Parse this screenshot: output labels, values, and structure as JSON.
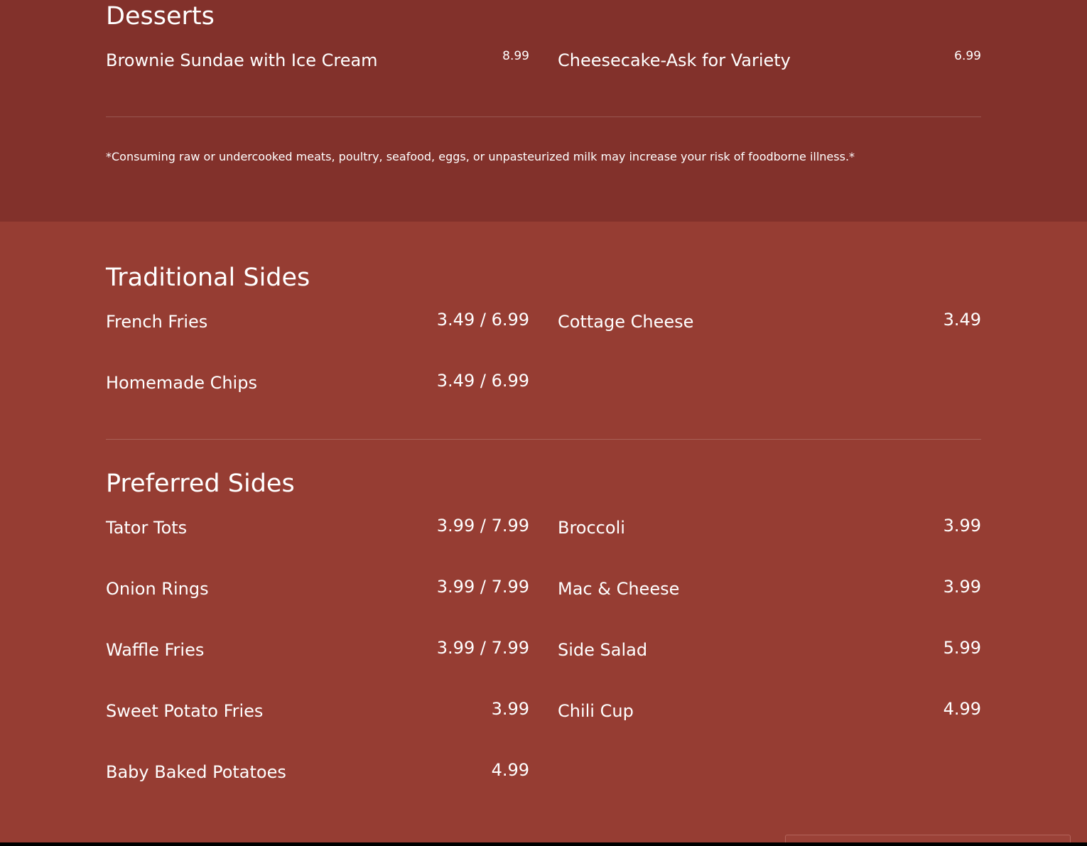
{
  "desserts": {
    "title": "Desserts",
    "items": [
      {
        "name": "Brownie Sundae with Ice Cream",
        "price": "8.99"
      },
      {
        "name": "Cheesecake-Ask for Variety",
        "price": "6.99"
      }
    ]
  },
  "notice": "*Consuming raw or undercooked meats, poultry, seafood, eggs, or unpasteurized milk may increase your risk of foodborne illness.*",
  "traditional_sides": {
    "title": "Traditional Sides",
    "items": [
      {
        "name": "French Fries",
        "price": "3.49 / 6.99"
      },
      {
        "name": "Cottage Cheese",
        "price": "3.49"
      },
      {
        "name": "Homemade Chips",
        "price": "3.49 / 6.99"
      }
    ]
  },
  "preferred_sides": {
    "title": "Preferred Sides",
    "items": [
      {
        "name": "Tator Tots",
        "price": "3.99 / 7.99"
      },
      {
        "name": "Broccoli",
        "price": "3.99"
      },
      {
        "name": "Onion Rings",
        "price": "3.99 / 7.99"
      },
      {
        "name": "Mac & Cheese",
        "price": "3.99"
      },
      {
        "name": "Waffle Fries",
        "price": "3.99 / 7.99"
      },
      {
        "name": "Side Salad",
        "price": "5.99"
      },
      {
        "name": "Sweet Potato Fries",
        "price": "3.99"
      },
      {
        "name": "Chili Cup",
        "price": "4.99"
      },
      {
        "name": "Baby Baked Potatoes",
        "price": "4.99"
      }
    ]
  },
  "colors": {
    "desserts_background": "#82312b",
    "sides_background": "#963d33",
    "text": "#ffffff"
  }
}
